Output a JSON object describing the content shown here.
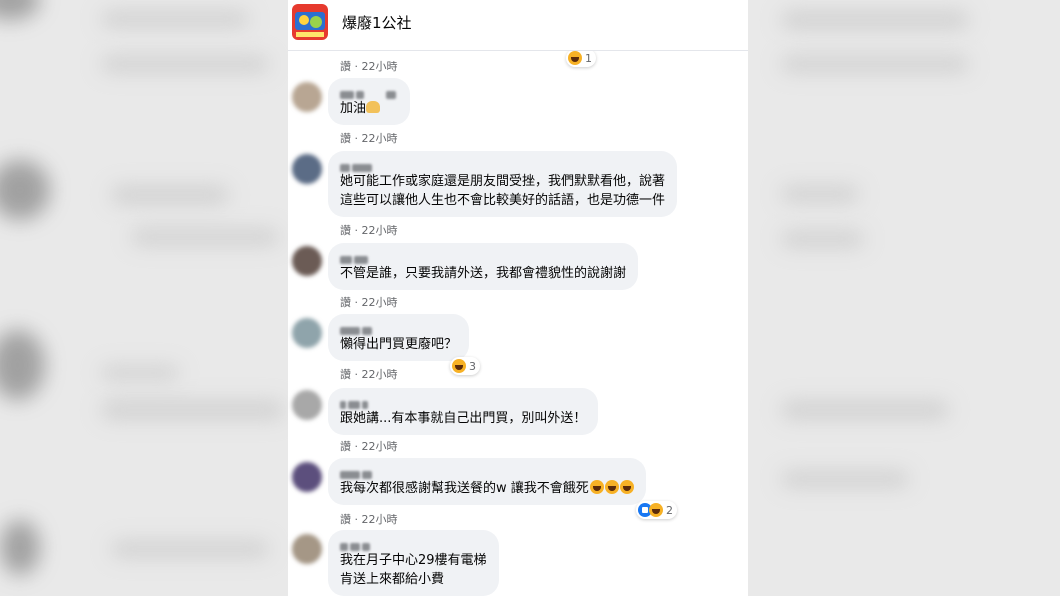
{
  "page": {
    "name": "爆廢1公社",
    "logo": "page-logo"
  },
  "top_reaction": {
    "icon": "haha-icon",
    "count": "1"
  },
  "comments": [
    {
      "meta": "讚 · 22小時"
    },
    {
      "text": "加油",
      "emoji": "flexed-biceps-icon",
      "meta": "讚 · 22小時"
    },
    {
      "lines": [
        "她可能工作或家庭還是朋友間受挫，我們默默看他，說著",
        "這些可以讓他人生也不會比較美好的話語，也是功德一件"
      ],
      "meta": "讚 · 22小時"
    },
    {
      "text": "不管是誰，只要我請外送，我都會禮貌性的說謝謝",
      "meta": "讚 · 22小時"
    },
    {
      "text": "懶得出門買更廢吧？",
      "meta": "讚 · 22小時",
      "reaction": {
        "icon": "haha-icon",
        "count": "3"
      }
    },
    {
      "text": "跟她講...有本事就自己出門買，別叫外送！",
      "meta": "讚 · 22小時"
    },
    {
      "text": "我每次都很感謝幫我送餐的w 讓我不會餓死",
      "meta": "讚 · 22小時",
      "reaction": {
        "icon": "like-haha-icon",
        "count": "2"
      }
    },
    {
      "lines": [
        "我在月子中心29樓有電梯",
        "肯送上來都給小費"
      ]
    }
  ],
  "colors": {
    "bubble": "#f0f2f5",
    "meta": "#65676b",
    "haha": "#f7b125",
    "like": "#1877f2"
  }
}
